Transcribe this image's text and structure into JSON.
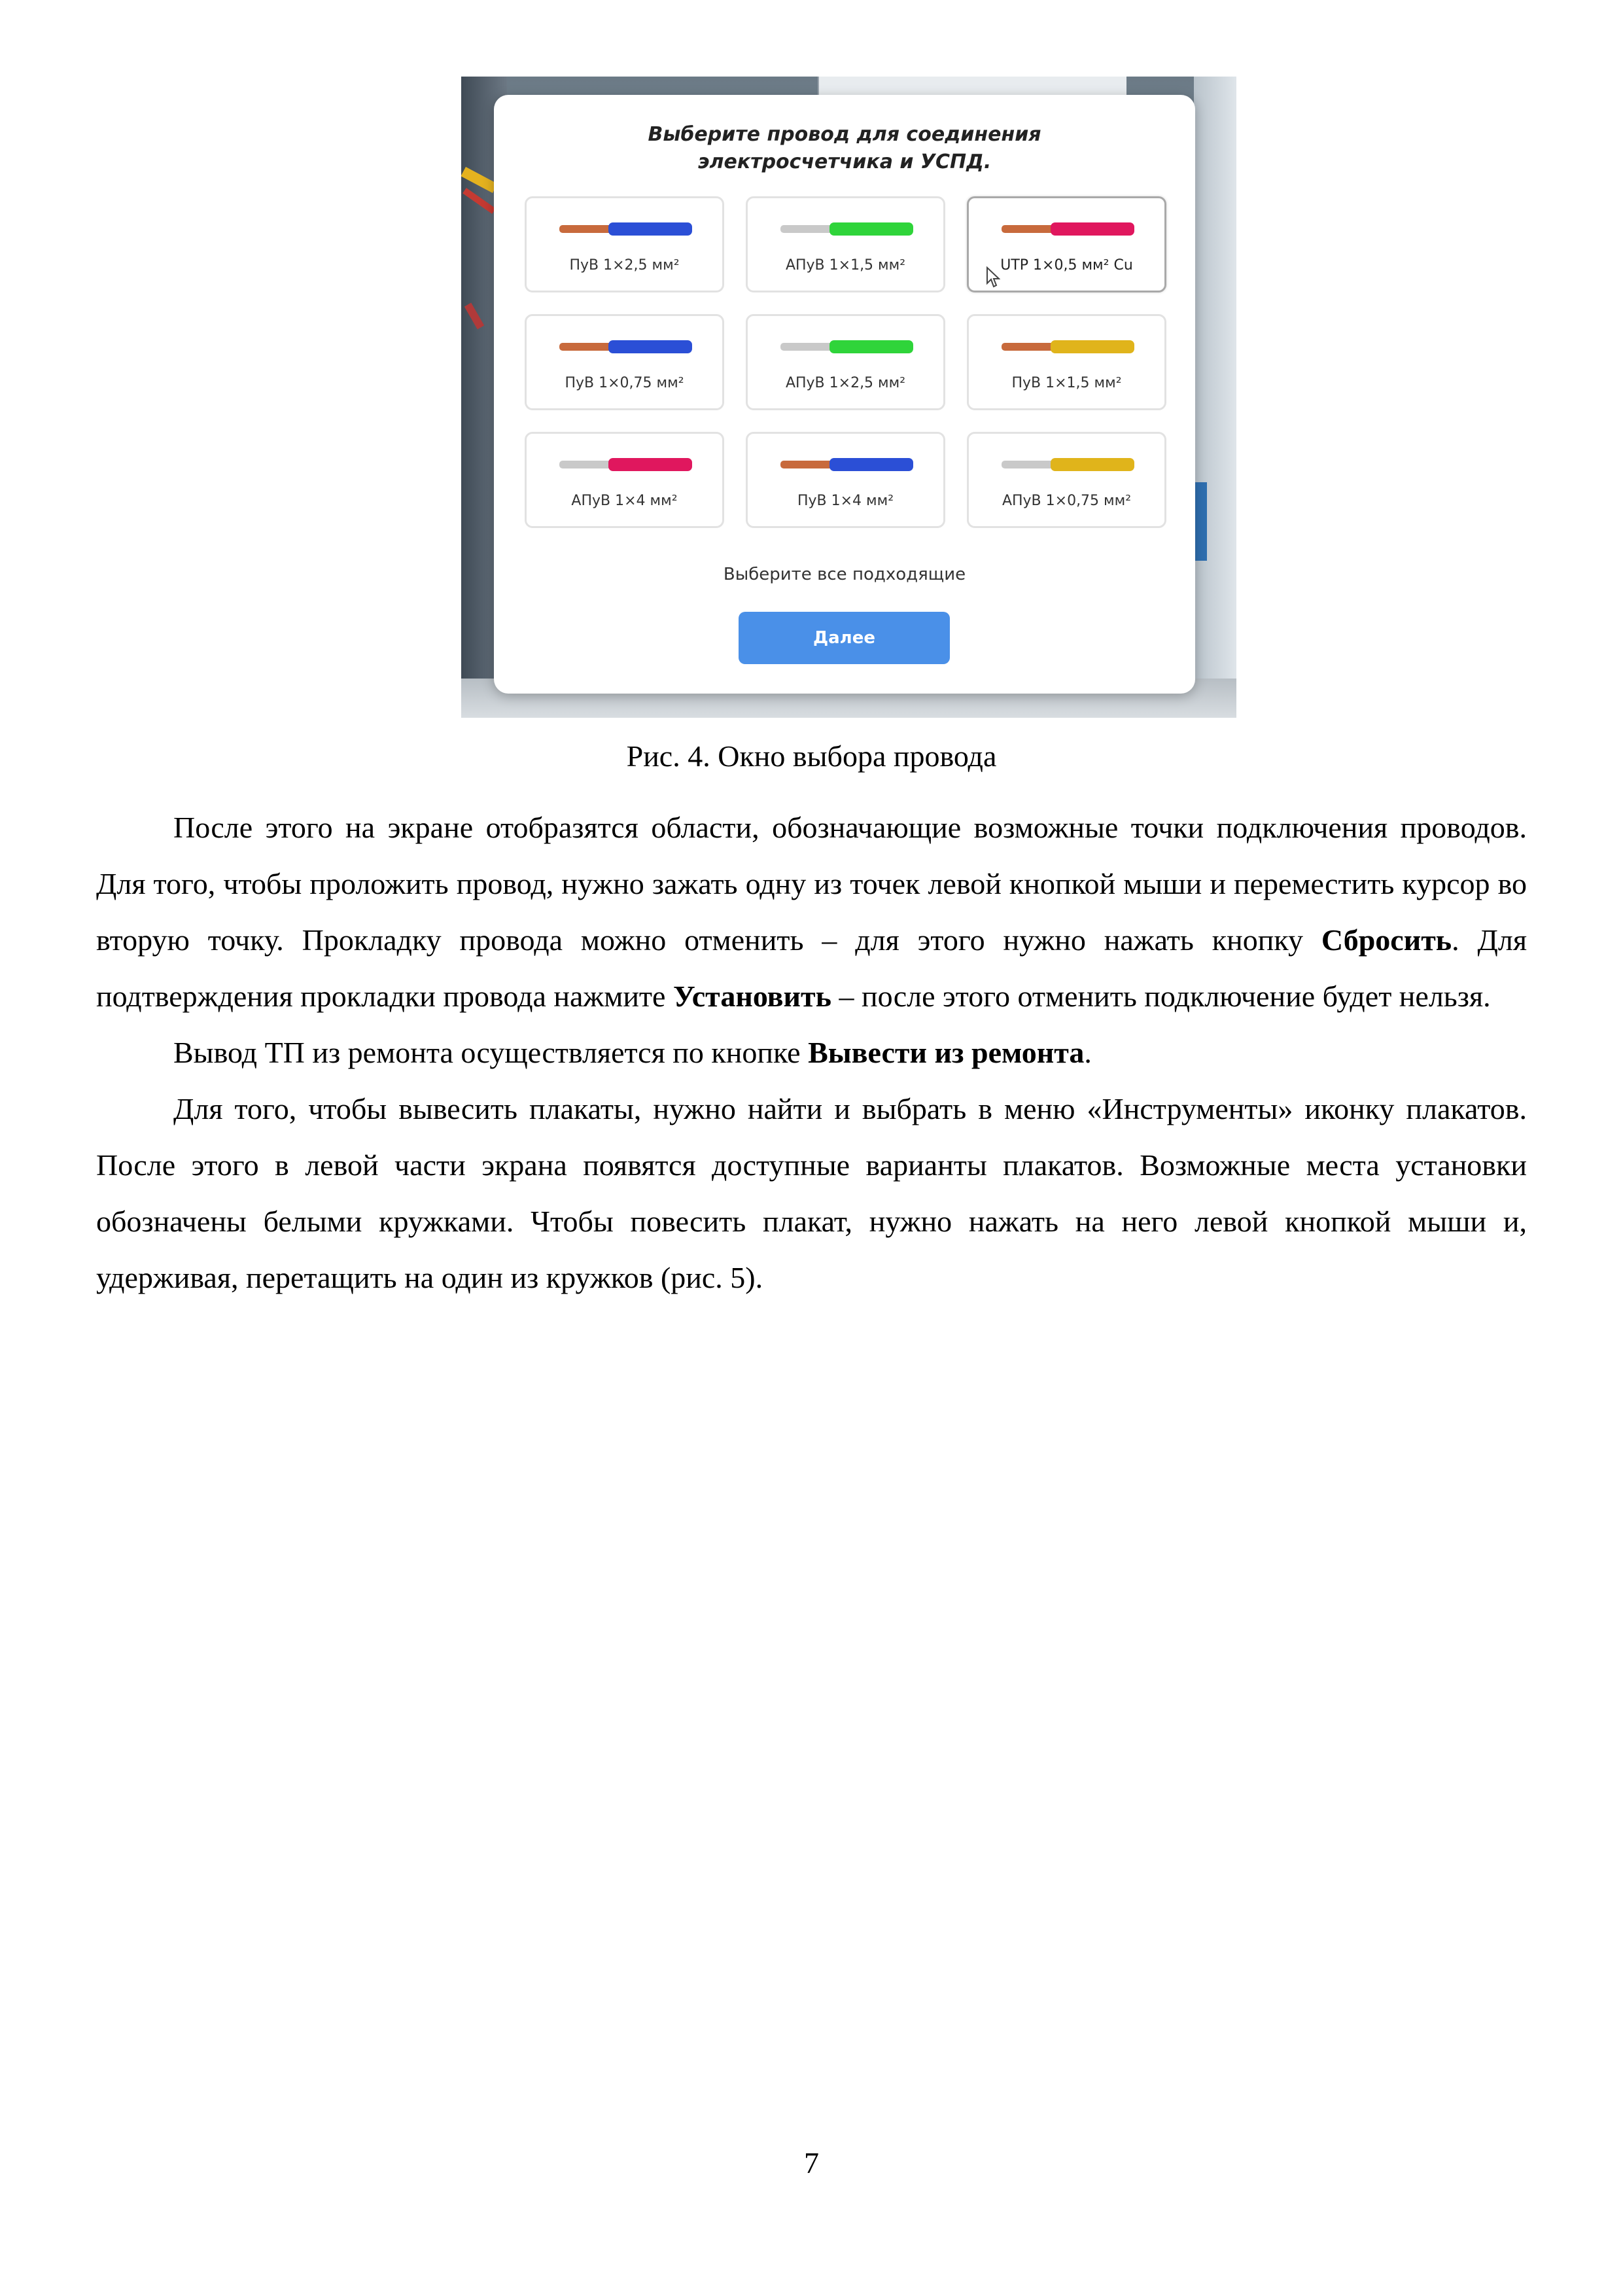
{
  "dialog": {
    "title": "Выберите провод для соединения\nэлектросчетчика и УСПД.",
    "options": [
      {
        "label": "ПуВ 1×2,5 мм²",
        "core": "copper",
        "insulation": "#2b4fd6",
        "selected": false
      },
      {
        "label": "АПуВ 1×1,5 мм²",
        "core": "aluminium",
        "insulation": "#2fd43a",
        "selected": false
      },
      {
        "label": "UTP 1×0,5 мм² Cu",
        "core": "copper",
        "insulation": "#e0175e",
        "selected": true
      },
      {
        "label": "ПуВ 1×0,75 мм²",
        "core": "copper",
        "insulation": "#2b4fd6",
        "selected": false
      },
      {
        "label": "АПуВ 1×2,5 мм²",
        "core": "aluminium",
        "insulation": "#2fd43a",
        "selected": false
      },
      {
        "label": "ПуВ 1×1,5 мм²",
        "core": "copper",
        "insulation": "#e0b41b",
        "selected": false
      },
      {
        "label": "АПуВ 1×4 мм²",
        "core": "aluminium",
        "insulation": "#e0175e",
        "selected": false
      },
      {
        "label": "ПуВ 1×4 мм²",
        "core": "copper",
        "insulation": "#2b4fd6",
        "selected": false
      },
      {
        "label": "АПуВ 1×0,75 мм²",
        "core": "aluminium",
        "insulation": "#e0b41b",
        "selected": false
      }
    ],
    "hint": "Выберите все подходящие",
    "next_label": "Далее"
  },
  "colors": {
    "accent": "#4a90e8",
    "copper": "#c86a3c",
    "aluminium": "#c9c9c9"
  },
  "figure_caption": "Рис. 4. Окно выбора провода",
  "paragraphs": {
    "p1": {
      "a": "После этого на экране отобразятся области, обозначающие возможные точки подключения проводов. Для того, чтобы проложить провод, нужно зажать одну из точек левой кнопкой мыши и переместить курсор во вторую точку. Прокладку провода можно отменить – для этого нужно нажать кнопку ",
      "b1": "Сбросить",
      "c": ". Для подтверждения прокладки провода нажмите ",
      "b2": "Установить",
      "d": " – после этого отменить подключение будет нельзя."
    },
    "p2": {
      "a": "Вывод ТП из ремонта осуществляется по кнопке ",
      "b": "Вывести из ремонта",
      "c": "."
    },
    "p3": "Для того, чтобы вывесить плакаты, нужно найти и выбрать в меню «Инструменты» иконку плакатов. После этого в левой части экрана появятся доступные варианты плакатов. Возможные места установки обозначены белыми кружками. Чтобы повесить плакат, нужно нажать на него левой кнопкой мыши и, удерживая, перетащить на один из кружков (рис. 5)."
  },
  "page_number": "7"
}
